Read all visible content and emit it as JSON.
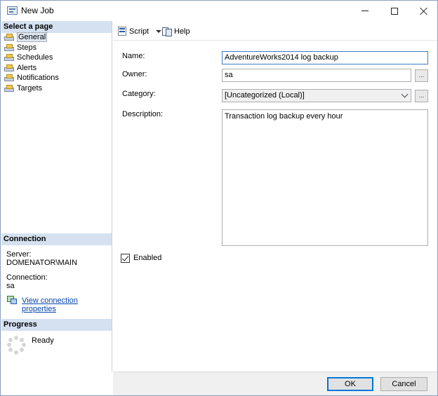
{
  "window": {
    "title": "New Job",
    "icon": "app-window-icon"
  },
  "title_controls": {
    "minimize_icon": "minimize-icon",
    "maximize_icon": "maximize-icon",
    "close_icon": "close-icon"
  },
  "left_pane": {
    "select_page_header": "Select a page",
    "pages": [
      {
        "label": "General",
        "icon": "page-icon",
        "selected": true
      },
      {
        "label": "Steps",
        "icon": "page-icon",
        "selected": false
      },
      {
        "label": "Schedules",
        "icon": "page-icon",
        "selected": false
      },
      {
        "label": "Alerts",
        "icon": "page-icon",
        "selected": false
      },
      {
        "label": "Notifications",
        "icon": "page-icon",
        "selected": false
      },
      {
        "label": "Targets",
        "icon": "page-icon",
        "selected": false
      }
    ],
    "connection": {
      "header": "Connection",
      "server_label": "Server:",
      "server_value": "DOMENATOR\\MAIN",
      "connection_label": "Connection:",
      "connection_value": "sa",
      "link_label": "View connection properties",
      "link_icon": "connection-properties-icon"
    },
    "progress": {
      "header": "Progress",
      "status": "Ready",
      "icon": "progress-spinner-icon"
    }
  },
  "toolbar": {
    "script_label": "Script",
    "script_icon": "script-icon",
    "help_label": "Help",
    "help_icon": "help-icon"
  },
  "form": {
    "name_label": "Name:",
    "name_value": "AdventureWorks2014 log backup",
    "owner_label": "Owner:",
    "owner_value": "sa",
    "owner_browse": "...",
    "category_label": "Category:",
    "category_value": "[Uncategorized (Local)]",
    "category_browse": "...",
    "description_label": "Description:",
    "description_value": "Transaction log backup every hour",
    "enabled_label": "Enabled",
    "enabled_checked": true
  },
  "footer": {
    "ok_label": "OK",
    "cancel_label": "Cancel"
  }
}
